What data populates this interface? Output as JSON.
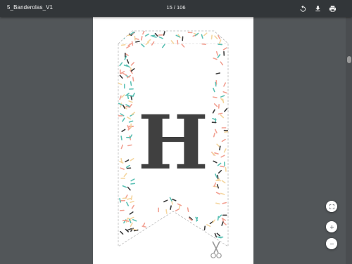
{
  "viewer": {
    "file_title": "5_Banderolas_V1",
    "page_indicator": "15 / 106"
  },
  "toolbar": {
    "icons": [
      "rotate-icon",
      "download-icon",
      "print-icon"
    ]
  },
  "banner": {
    "letter": "H",
    "letter_color": "#404040",
    "confetti_colors": [
      "#f2a193",
      "#f5d6a0",
      "#5cc1b5",
      "#3d3d3d"
    ]
  },
  "zoom_controls": {
    "icons": [
      "fit-page-icon",
      "zoom-in-icon",
      "zoom-out-icon"
    ]
  },
  "colors": {
    "toolbar_bg": "#323639",
    "viewer_bg": "#525659"
  }
}
